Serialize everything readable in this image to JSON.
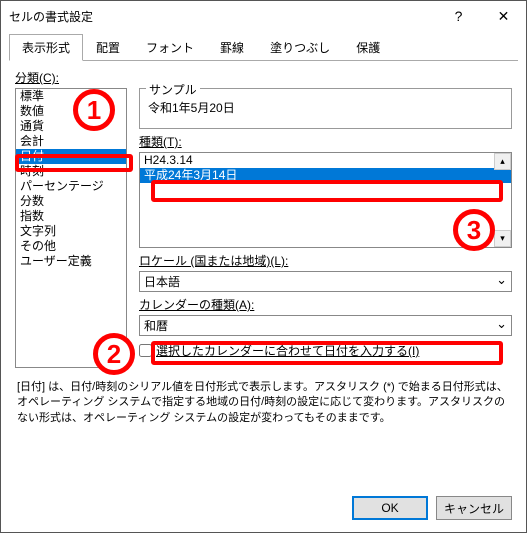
{
  "window": {
    "title": "セルの書式設定",
    "help_icon": "?",
    "close_icon": "✕"
  },
  "tabs": {
    "items": [
      "表示形式",
      "配置",
      "フォント",
      "罫線",
      "塗りつぶし",
      "保護"
    ],
    "active_index": 0
  },
  "category": {
    "label": "分類(C):",
    "items": [
      "標準",
      "数値",
      "通貨",
      "会計",
      "日付",
      "時刻",
      "パーセンテージ",
      "分数",
      "指数",
      "文字列",
      "その他",
      "ユーザー定義"
    ],
    "selected_index": 4
  },
  "sample": {
    "title": "サンプル",
    "value": "令和1年5月20日"
  },
  "type": {
    "label": "種類(T):",
    "items": [
      "H24.3.14",
      "平成24年3月14日"
    ],
    "selected_index": 1
  },
  "locale": {
    "label": "ロケール (国または地域)(L):",
    "value": "日本語"
  },
  "calendar": {
    "label": "カレンダーの種類(A):",
    "value": "和暦"
  },
  "checkbox": {
    "label": "選択したカレンダーに合わせて日付を入力する(I)"
  },
  "description": "[日付] は、日付/時刻のシリアル値を日付形式で表示します。アスタリスク (*) で始まる日付形式は、オペレーティング システムで指定する地域の日付/時刻の設定に応じて変わります。アスタリスクのない形式は、オペレーティング システムの設定が変わってもそのままです。",
  "buttons": {
    "ok": "OK",
    "cancel": "キャンセル"
  },
  "annotations": {
    "n1": "1",
    "n2": "2",
    "n3": "3"
  }
}
